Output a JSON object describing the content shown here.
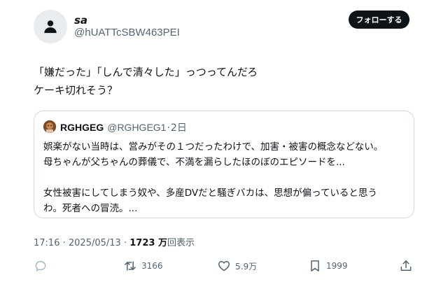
{
  "author": {
    "display_name": "sa",
    "handle": "@hUATTcSBW463PEI",
    "avatar_icon": "default-user-icon"
  },
  "follow_button": {
    "label": "フォローする"
  },
  "tweet": {
    "lines": [
      "「嫌だった」「しんで清々した」っつってんだろ",
      "ケーキ切れそう？"
    ]
  },
  "quote": {
    "name": "RGHGEG",
    "handle": "@RGHGEG1",
    "separator": "·",
    "date": "2日",
    "lines": [
      "娯楽がない当時は、営みがその１つだったわけで、加害・被害の概念などない。",
      "母ちゃんが父ちゃんの葬儀で、不満を漏らしたほのぼのエピソードを...",
      "",
      "女性被害にしてしまう奴や、多産DVだと騒ぎバカは、思想が偏っていると思う",
      "わ。死者への冒涜。..."
    ]
  },
  "meta": {
    "time": "17:16",
    "separator": "·",
    "date": "2025/05/13",
    "dot": "·",
    "views_count": "1723 万",
    "views_label": "回表示"
  },
  "actions": {
    "reply": {
      "icon": "reply-icon",
      "count": ""
    },
    "retweet": {
      "icon": "retweet-icon",
      "count": "3166"
    },
    "like": {
      "icon": "heart-icon",
      "count": "5.9万"
    },
    "bookmark": {
      "icon": "bookmark-icon",
      "count": "1999"
    },
    "share": {
      "icon": "share-icon"
    }
  },
  "colors": {
    "text": "#0f1419",
    "secondary": "#536471",
    "border": "#cfd9de",
    "button_bg": "#0f1419"
  }
}
